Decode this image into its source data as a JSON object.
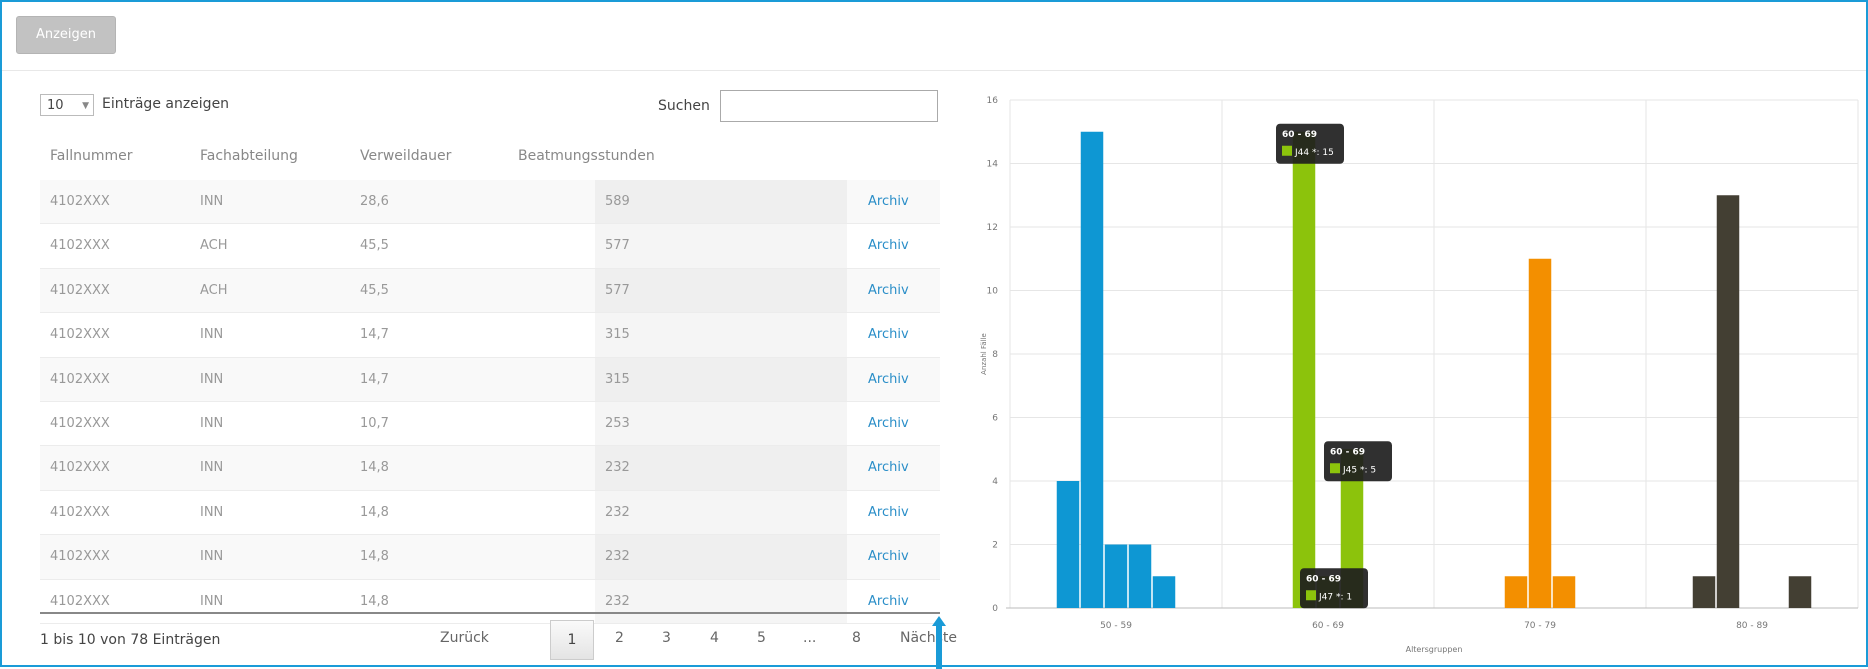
{
  "toolbar": {
    "show_button": "Anzeigen"
  },
  "table": {
    "length_value": "10",
    "length_label": "Einträge anzeigen",
    "search_label": "Suchen",
    "search_value": "",
    "columns": [
      "Fallnummer",
      "Fachabteilung",
      "Verweildauer",
      "Beatmungsstunden"
    ],
    "rows": [
      {
        "fall": "4102XXX",
        "abt": "INN",
        "dauer": "28,6",
        "stunden": "589",
        "link": "Archiv"
      },
      {
        "fall": "4102XXX",
        "abt": "ACH",
        "dauer": "45,5",
        "stunden": "577",
        "link": "Archiv"
      },
      {
        "fall": "4102XXX",
        "abt": "ACH",
        "dauer": "45,5",
        "stunden": "577",
        "link": "Archiv"
      },
      {
        "fall": "4102XXX",
        "abt": "INN",
        "dauer": "14,7",
        "stunden": "315",
        "link": "Archiv"
      },
      {
        "fall": "4102XXX",
        "abt": "INN",
        "dauer": "14,7",
        "stunden": "315",
        "link": "Archiv"
      },
      {
        "fall": "4102XXX",
        "abt": "INN",
        "dauer": "10,7",
        "stunden": "253",
        "link": "Archiv"
      },
      {
        "fall": "4102XXX",
        "abt": "INN",
        "dauer": "14,8",
        "stunden": "232",
        "link": "Archiv"
      },
      {
        "fall": "4102XXX",
        "abt": "INN",
        "dauer": "14,8",
        "stunden": "232",
        "link": "Archiv"
      },
      {
        "fall": "4102XXX",
        "abt": "INN",
        "dauer": "14,8",
        "stunden": "232",
        "link": "Archiv"
      },
      {
        "fall": "4102XXX",
        "abt": "INN",
        "dauer": "14,8",
        "stunden": "232",
        "link": "Archiv"
      }
    ],
    "info": "1 bis 10 von 78 Einträgen",
    "pager": {
      "prev": "Zurück",
      "current": "1",
      "pages": [
        "2",
        "3",
        "4",
        "5",
        "...",
        "8"
      ],
      "next": "Nächste"
    }
  },
  "chart_data": {
    "type": "bar",
    "title": "",
    "xlabel": "Altersgruppen",
    "ylabel": "Anzahl Fälle",
    "ylim": [
      0,
      16
    ],
    "yticks": [
      "0",
      "2",
      "4",
      "6",
      "8",
      "10",
      "12",
      "14",
      "16"
    ],
    "grid": true,
    "categories": [
      "50 - 59",
      "60 - 69",
      "70 - 79",
      "80 - 89"
    ],
    "groups": [
      {
        "category": "50 - 59",
        "color": "#0e97d3",
        "values": [
          4,
          15,
          2,
          2,
          1
        ]
      },
      {
        "category": "60 - 69",
        "color": "#8cc30c",
        "values": [
          15,
          1,
          5
        ]
      },
      {
        "category": "70 - 79",
        "color": "#f38f00",
        "values": [
          1,
          11,
          1
        ]
      },
      {
        "category": "80 - 89",
        "color": "#433f33",
        "values": [
          1,
          13,
          0,
          0,
          1
        ]
      }
    ],
    "tooltips": [
      {
        "category": "60 - 69",
        "bar": 0,
        "title": "60 - 69",
        "text": "J44 *: 15"
      },
      {
        "category": "60 - 69",
        "bar": 1,
        "title": "60 - 69",
        "text": "J47 *: 1"
      },
      {
        "category": "60 - 69",
        "bar": 2,
        "title": "60 - 69",
        "text": "J45 *: 5"
      }
    ]
  },
  "colors": {
    "accent": "#1a9bd7",
    "link": "#2a8ec8"
  }
}
